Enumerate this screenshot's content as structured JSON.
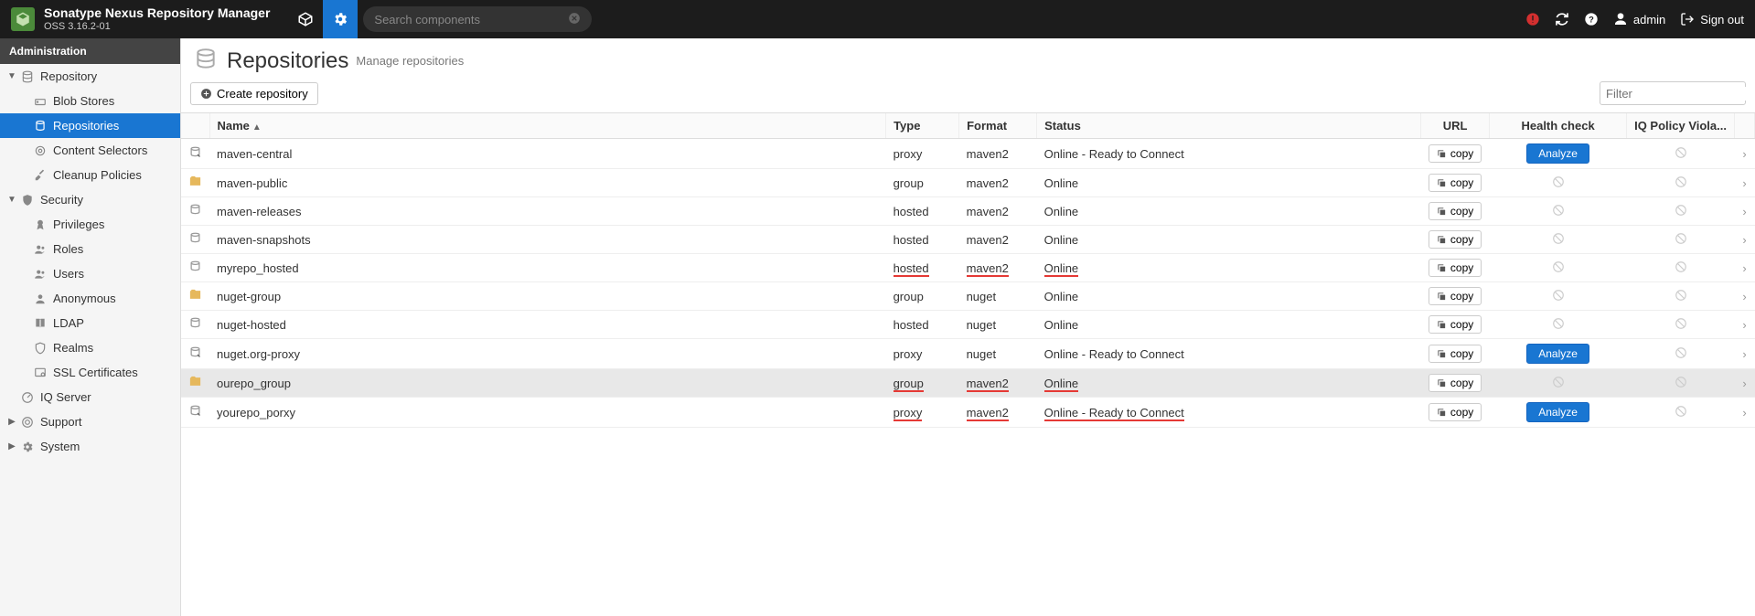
{
  "header": {
    "title": "Sonatype Nexus Repository Manager",
    "version": "OSS 3.16.2-01",
    "search_placeholder": "Search components",
    "user": "admin",
    "signout": "Sign out"
  },
  "sidebar": {
    "section": "Administration",
    "tree": [
      {
        "label": "Repository",
        "icon": "database",
        "expanded": true,
        "level": 0,
        "children": [
          {
            "label": "Blob Stores",
            "icon": "hdd",
            "level": 1
          },
          {
            "label": "Repositories",
            "icon": "repo",
            "level": 1,
            "selected": true
          },
          {
            "label": "Content Selectors",
            "icon": "target",
            "level": 1
          },
          {
            "label": "Cleanup Policies",
            "icon": "broom",
            "level": 1
          }
        ]
      },
      {
        "label": "Security",
        "icon": "shield",
        "expanded": true,
        "level": 0,
        "children": [
          {
            "label": "Privileges",
            "icon": "ribbon",
            "level": 1
          },
          {
            "label": "Roles",
            "icon": "users",
            "level": 1
          },
          {
            "label": "Users",
            "icon": "users",
            "level": 1
          },
          {
            "label": "Anonymous",
            "icon": "user",
            "level": 1
          },
          {
            "label": "LDAP",
            "icon": "book",
            "level": 1
          },
          {
            "label": "Realms",
            "icon": "shield-o",
            "level": 1
          },
          {
            "label": "SSL Certificates",
            "icon": "cert",
            "level": 1
          }
        ]
      },
      {
        "label": "IQ Server",
        "icon": "dashboard",
        "expanded": false,
        "level": 0,
        "leaf": true
      },
      {
        "label": "Support",
        "icon": "life-ring",
        "expanded": false,
        "level": 0
      },
      {
        "label": "System",
        "icon": "gear",
        "expanded": false,
        "level": 0
      }
    ]
  },
  "page": {
    "title": "Repositories",
    "subtitle": "Manage repositories",
    "create_btn": "Create repository",
    "filter_placeholder": "Filter"
  },
  "columns": {
    "name": "Name",
    "type": "Type",
    "format": "Format",
    "status": "Status",
    "url": "URL",
    "health": "Health check",
    "iq": "IQ Policy Viola..."
  },
  "copy_label": "copy",
  "analyze_label": "Analyze",
  "rows": [
    {
      "icon": "proxy",
      "name": "maven-central",
      "type": "proxy",
      "format": "maven2",
      "status": "Online - Ready to Connect",
      "analyze": true
    },
    {
      "icon": "group",
      "name": "maven-public",
      "type": "group",
      "format": "maven2",
      "status": "Online"
    },
    {
      "icon": "hosted",
      "name": "maven-releases",
      "type": "hosted",
      "format": "maven2",
      "status": "Online"
    },
    {
      "icon": "hosted",
      "name": "maven-snapshots",
      "type": "hosted",
      "format": "maven2",
      "status": "Online"
    },
    {
      "icon": "hosted",
      "name": "myrepo_hosted",
      "type": "hosted",
      "format": "maven2",
      "status": "Online",
      "underline": true
    },
    {
      "icon": "group",
      "name": "nuget-group",
      "type": "group",
      "format": "nuget",
      "status": "Online"
    },
    {
      "icon": "hosted",
      "name": "nuget-hosted",
      "type": "hosted",
      "format": "nuget",
      "status": "Online"
    },
    {
      "icon": "proxy",
      "name": "nuget.org-proxy",
      "type": "proxy",
      "format": "nuget",
      "status": "Online - Ready to Connect",
      "analyze": true
    },
    {
      "icon": "group",
      "name": "ourepo_group",
      "type": "group",
      "format": "maven2",
      "status": "Online",
      "hovered": true,
      "underline": true
    },
    {
      "icon": "proxy",
      "name": "yourepo_porxy",
      "type": "proxy",
      "format": "maven2",
      "status": "Online - Ready to Connect",
      "analyze": true,
      "underline": true
    }
  ]
}
